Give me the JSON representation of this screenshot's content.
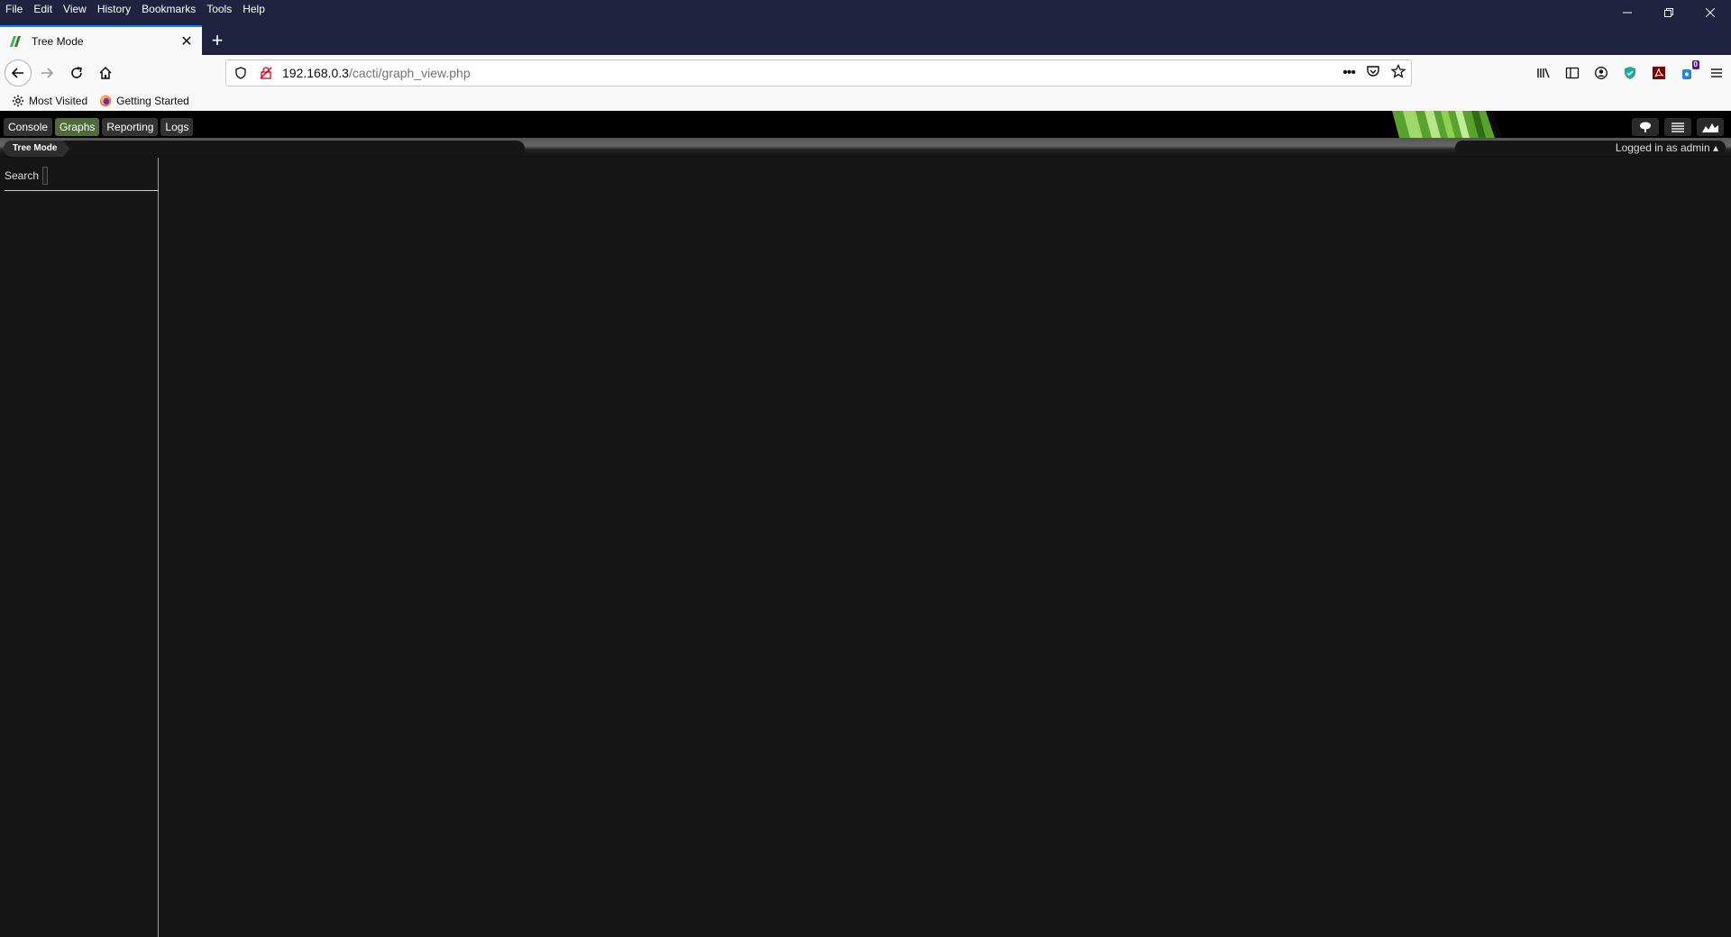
{
  "browser": {
    "menu": [
      "File",
      "Edit",
      "View",
      "History",
      "Bookmarks",
      "Tools",
      "Help"
    ],
    "tab_title": "Tree Mode",
    "url_host": "192.168.0.3",
    "url_path": "/cacti/graph_view.php",
    "bookmarks": [
      "Most Visited",
      "Getting Started"
    ],
    "badge_count": "0"
  },
  "cacti": {
    "tabs": [
      "Console",
      "Graphs",
      "Reporting",
      "Logs"
    ],
    "active_tab": "Graphs",
    "breadcrumb": "Tree Mode",
    "user_info": "Logged in as admin ▴",
    "search_label": "Search",
    "search_value": ""
  },
  "colors": {
    "chrome_dark": "#202340",
    "page_bg": "#161616",
    "active_tab": "#4e6b3a",
    "logo_green": "#7bc043"
  }
}
